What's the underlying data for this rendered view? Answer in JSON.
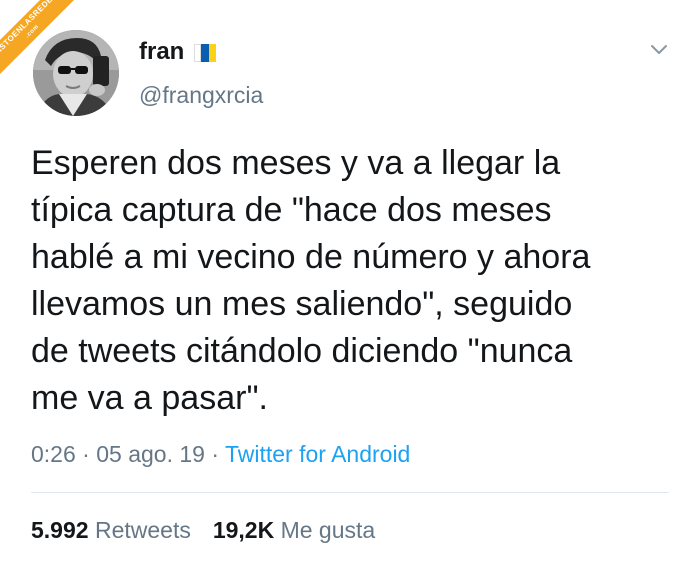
{
  "watermark": {
    "text": "VISTOENLASREDES",
    "sub": ".com"
  },
  "user": {
    "display_name": "fran",
    "handle": "@frangxrcia",
    "flag_icon": "canary-islands-flag-icon",
    "flag_colors": [
      "#ffffff",
      "#0a5eb0",
      "#fcd116"
    ]
  },
  "tweet": {
    "text": "Esperen dos meses y va a llegar la\ntípica captura de \"hace dos meses\nhablé a mi vecino de número y ahora\nllevamos un mes saliendo\", seguido\nde tweets citándolo diciendo \"nunca\nme va a pasar\".",
    "time": "0:26",
    "date": "05 ago. 19",
    "separator": "·",
    "source": "Twitter for Android"
  },
  "stats": {
    "retweets_count": "5.992",
    "retweets_label": "Retweets",
    "likes_count": "19,2K",
    "likes_label": "Me gusta"
  },
  "colors": {
    "text": "#14171a",
    "secondary": "#657786",
    "link": "#1da1f2",
    "divider": "#e1e8ed",
    "watermark": "#f5a623"
  }
}
